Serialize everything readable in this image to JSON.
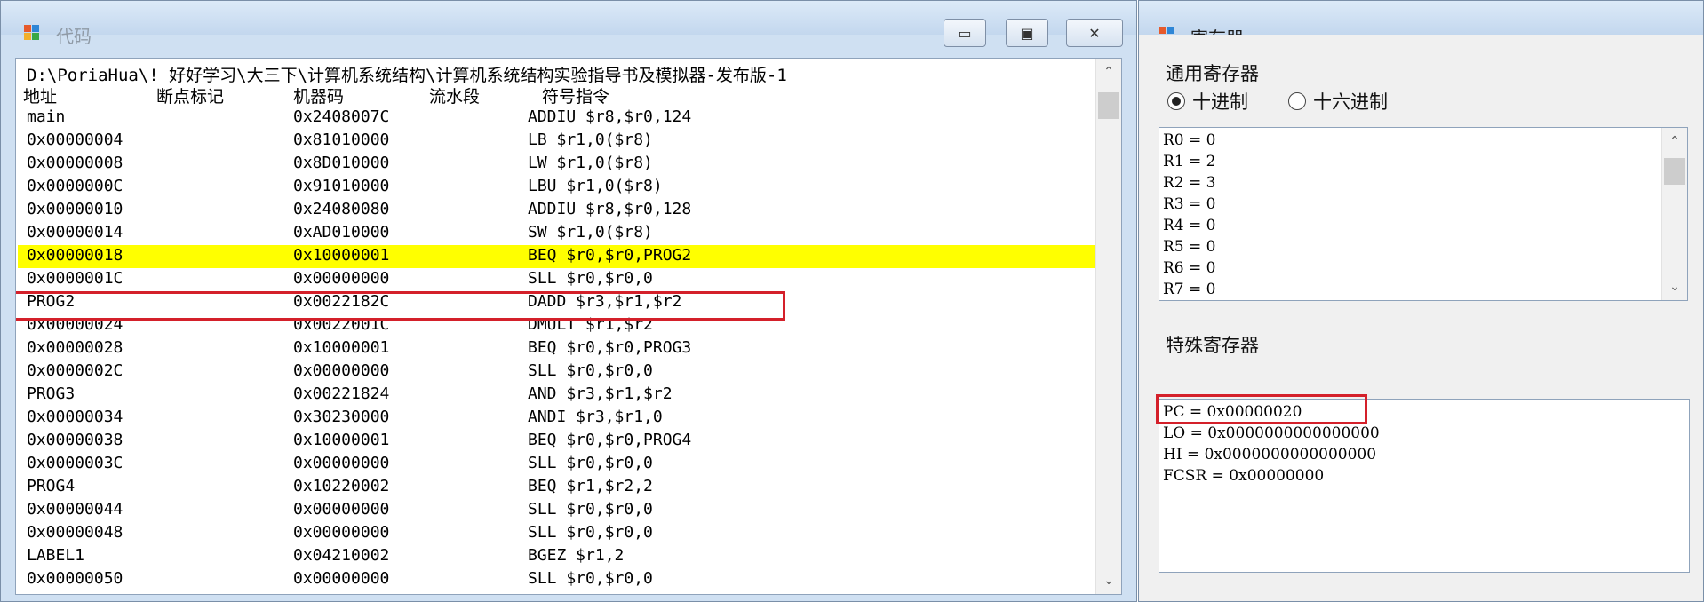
{
  "code_window": {
    "title": "代码",
    "buttons": {
      "minimize": "▭",
      "maximize": "▣",
      "close": "✕"
    },
    "path": "D:\\PoriaHua\\! 好好学习\\大三下\\计算机系统结构\\计算机系统结构实验指导书及模拟器-发布版-1",
    "columns": [
      "地址",
      "断点标记",
      "机器码",
      "流水段",
      "符号指令"
    ],
    "rows": [
      {
        "addr": "main",
        "code": "0x2408007C",
        "instr": "ADDIU $r8,$r0,124"
      },
      {
        "addr": "0x00000004",
        "code": "0x81010000",
        "instr": "LB $r1,0($r8)"
      },
      {
        "addr": "0x00000008",
        "code": "0x8D010000",
        "instr": "LW $r1,0($r8)"
      },
      {
        "addr": "0x0000000C",
        "code": "0x91010000",
        "instr": "LBU $r1,0($r8)"
      },
      {
        "addr": "0x00000010",
        "code": "0x24080080",
        "instr": "ADDIU $r8,$r0,128"
      },
      {
        "addr": "0x00000014",
        "code": "0xAD010000",
        "instr": "SW $r1,0($r8)"
      },
      {
        "addr": "0x00000018",
        "code": "0x10000001",
        "instr": "BEQ $r0,$r0,PROG2",
        "highlight": true
      },
      {
        "addr": "0x0000001C",
        "code": "0x00000000",
        "instr": "SLL $r0,$r0,0"
      },
      {
        "addr": "PROG2",
        "code": "0x0022182C",
        "instr": "DADD $r3,$r1,$r2"
      },
      {
        "addr": "0x00000024",
        "code": "0x0022001C",
        "instr": "DMULT $r1,$r2"
      },
      {
        "addr": "0x00000028",
        "code": "0x10000001",
        "instr": "BEQ $r0,$r0,PROG3"
      },
      {
        "addr": "0x0000002C",
        "code": "0x00000000",
        "instr": "SLL $r0,$r0,0"
      },
      {
        "addr": "PROG3",
        "code": "0x00221824",
        "instr": "AND $r3,$r1,$r2"
      },
      {
        "addr": "0x00000034",
        "code": "0x30230000",
        "instr": "ANDI $r3,$r1,0"
      },
      {
        "addr": "0x00000038",
        "code": "0x10000001",
        "instr": "BEQ $r0,$r0,PROG4"
      },
      {
        "addr": "0x0000003C",
        "code": "0x00000000",
        "instr": "SLL $r0,$r0,0"
      },
      {
        "addr": "PROG4",
        "code": "0x10220002",
        "instr": "BEQ $r1,$r2,2"
      },
      {
        "addr": "0x00000044",
        "code": "0x00000000",
        "instr": "SLL $r0,$r0,0"
      },
      {
        "addr": "0x00000048",
        "code": "0x00000000",
        "instr": "SLL $r0,$r0,0"
      },
      {
        "addr": "LABEL1",
        "code": "0x04210002",
        "instr": "BGEZ $r1,2"
      },
      {
        "addr": "0x00000050",
        "code": "0x00000000",
        "instr": "SLL $r0,$r0,0"
      }
    ]
  },
  "reg_window": {
    "title": "寄存器",
    "general_label": "通用寄存器",
    "radix_options": [
      {
        "label": "十进制",
        "selected": true
      },
      {
        "label": "十六进制",
        "selected": false
      }
    ],
    "general_registers": [
      "R0 = 0",
      "R1 = 2",
      "R2 = 3",
      "R3 = 0",
      "R4 = 0",
      "R5 = 0",
      "R6 = 0",
      "R7 = 0"
    ],
    "special_label": "特殊寄存器",
    "special_registers": [
      "PC = 0x00000020",
      "LO = 0x0000000000000000",
      "HI = 0x0000000000000000",
      "FCSR = 0x00000000"
    ]
  },
  "colors": {
    "highlight_row": "#ffff00",
    "annotation_box": "#d4202a",
    "window_frame": "#cfe0f2"
  }
}
